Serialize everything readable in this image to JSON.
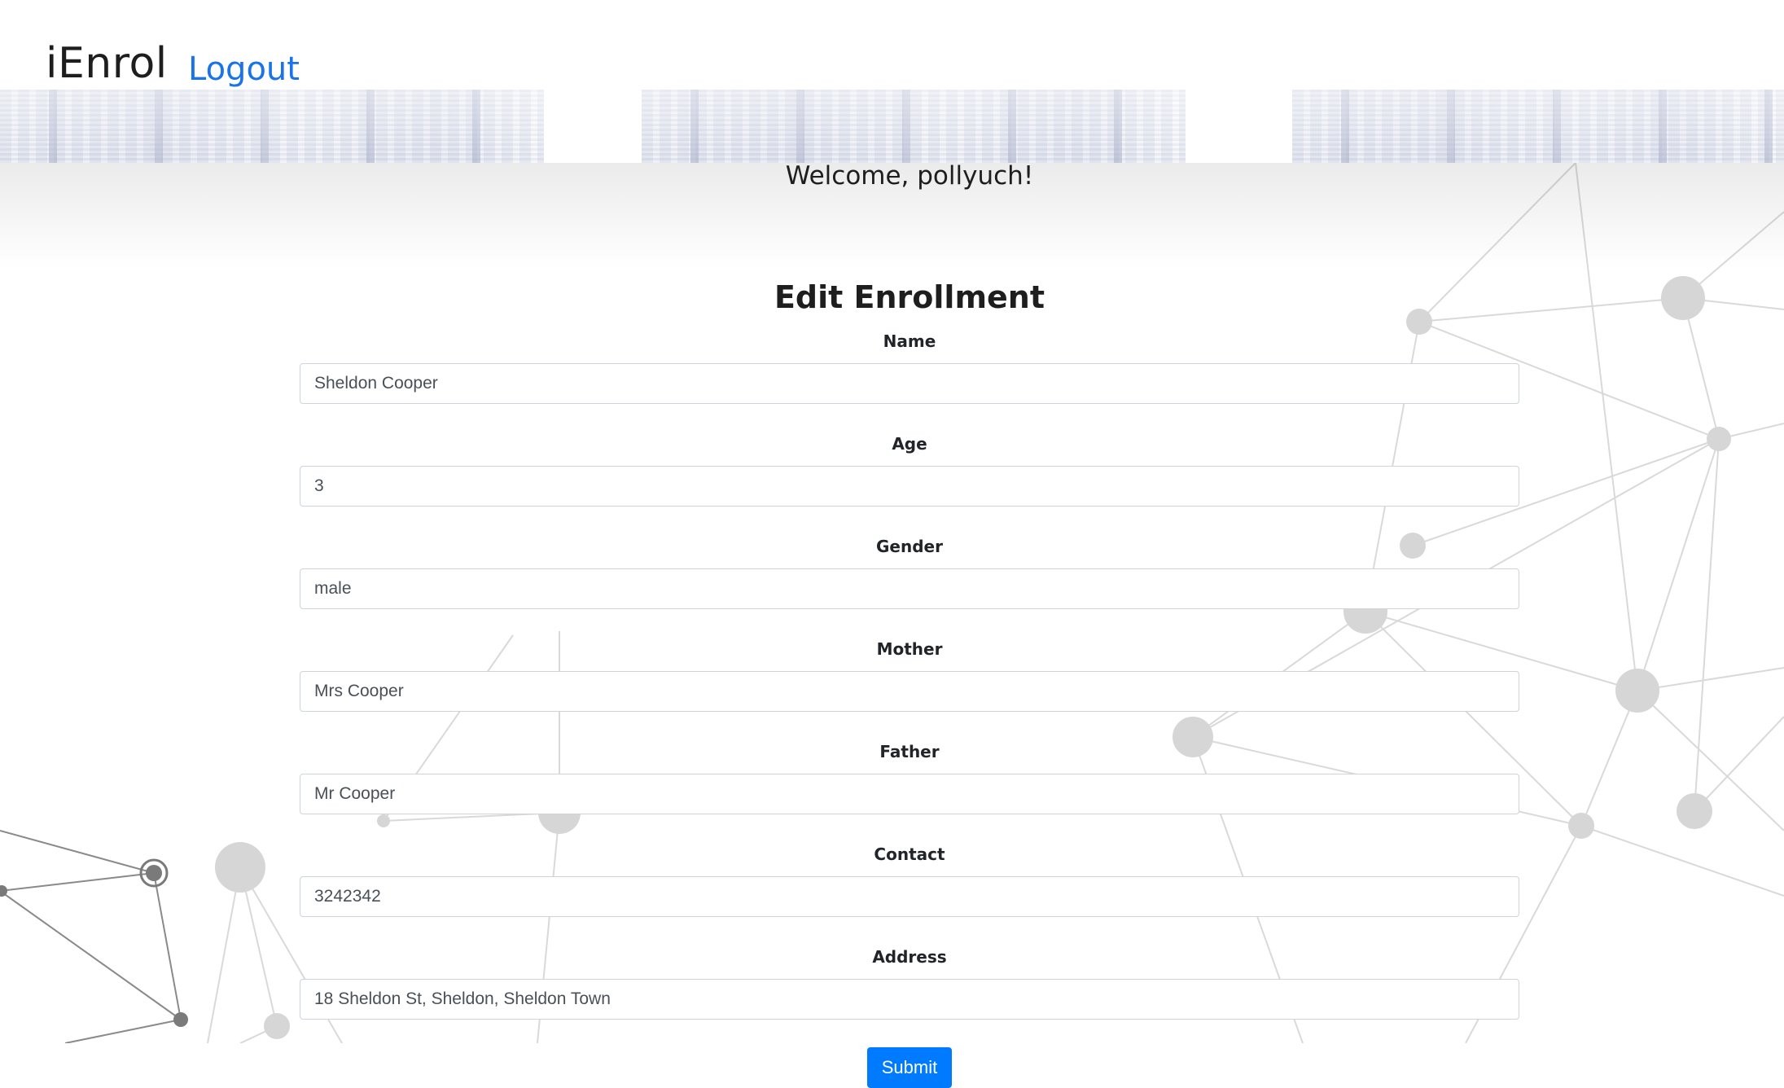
{
  "header": {
    "brand": "iEnrol",
    "logout_label": "Logout"
  },
  "welcome": "Welcome, pollyuch!",
  "form": {
    "title": "Edit Enrollment",
    "fields": [
      {
        "label": "Name",
        "value": "Sheldon Cooper"
      },
      {
        "label": "Age",
        "value": "3"
      },
      {
        "label": "Gender",
        "value": "male"
      },
      {
        "label": "Mother",
        "value": "Mrs Cooper"
      },
      {
        "label": "Father",
        "value": "Mr Cooper"
      },
      {
        "label": "Contact",
        "value": "3242342"
      },
      {
        "label": "Address",
        "value": "18 Sheldon St, Sheldon, Sheldon Town"
      }
    ],
    "submit_label": "Submit"
  },
  "colors": {
    "link": "#1a73e8",
    "primary_button": "#007bff"
  }
}
